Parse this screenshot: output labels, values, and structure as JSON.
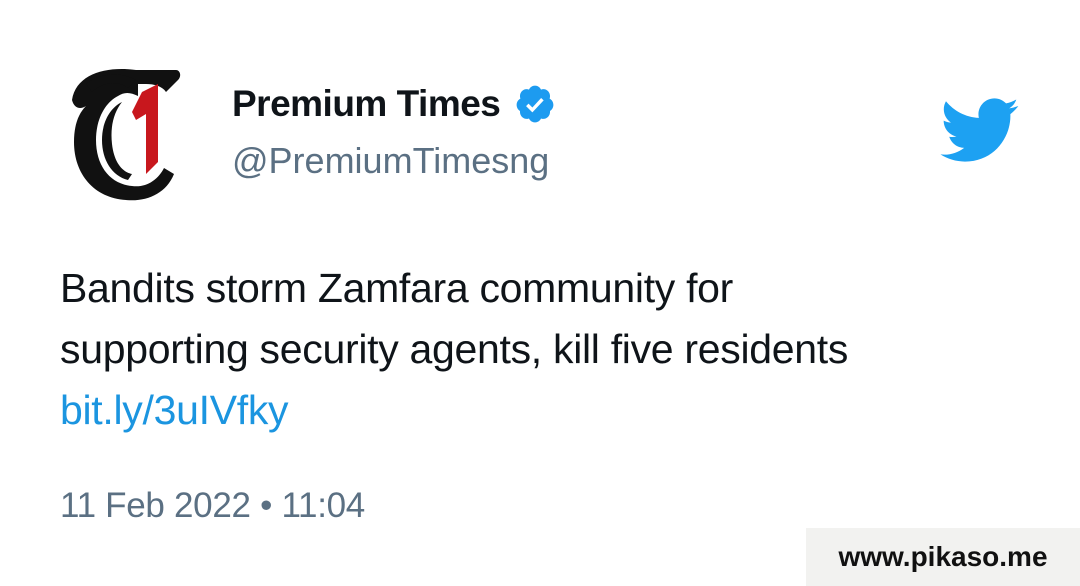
{
  "account": {
    "display_name": "Premium Times",
    "handle": "@PremiumTimesng",
    "avatar_icon": "premium-times-logo-icon",
    "verified_icon": "verified-badge-icon",
    "verified_color": "#1d9bf0"
  },
  "tweet": {
    "text_line1": "Bandits storm Zamfara community for",
    "text_line2": "supporting security agents, kill five residents",
    "link": "bit.ly/3uIVfky",
    "link_color": "#1b95e0",
    "timestamp": "11 Feb 2022 • 11:04"
  },
  "brand": {
    "logo_icon": "twitter-bird-icon",
    "logo_color": "#1da1f2"
  },
  "watermark": {
    "text": "www.pikaso.me"
  }
}
